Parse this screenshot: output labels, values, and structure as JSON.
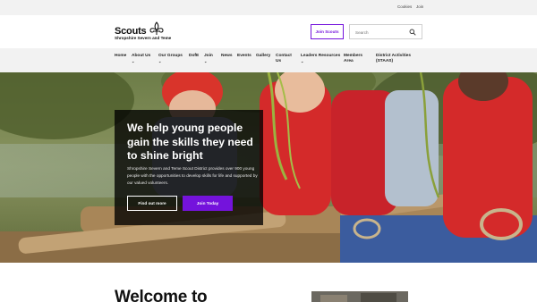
{
  "utility": {
    "cookies": "Cookies",
    "join": "Join"
  },
  "header": {
    "logo_word": "Scouts",
    "logo_subtitle": "Shropshire Severn and Teme",
    "join_button": "Join Scouts",
    "search_placeholder": "Search"
  },
  "nav": {
    "items": [
      {
        "label": "Home"
      },
      {
        "label": "About Us",
        "chevron": "⌄"
      },
      {
        "label": "Our Groups",
        "chevron": "⌄"
      },
      {
        "label": "DofE"
      },
      {
        "label": "Join",
        "chevron": "⌄"
      },
      {
        "label": "News"
      },
      {
        "label": "Events"
      },
      {
        "label": "Gallery"
      },
      {
        "label_line1": "Contact",
        "label_line2": "Us"
      },
      {
        "label": "Leaders Resources",
        "chevron": "⌄"
      },
      {
        "label_line1": "Members",
        "label_line2": "Area"
      },
      {
        "label_line1": "District Activities",
        "label_line2": "(STAAS)"
      }
    ]
  },
  "hero": {
    "title": "We help young people gain the skills they need to shine bright",
    "text": "Shropshire Severn and Teme Scout District provides over 900 young people with the opportunities to develop skills for life and supported by our valued volunteers.",
    "find_out_more": "Find out more",
    "join_today": "Join Today"
  },
  "welcome": {
    "heading": "Welcome to"
  },
  "colors": {
    "brand_purple": "#7413dc",
    "nav_bg": "#f2f2f2",
    "hero_box": "#000000"
  },
  "icons": {
    "logo": "fleur-de-lis-icon",
    "search": "search-icon"
  }
}
